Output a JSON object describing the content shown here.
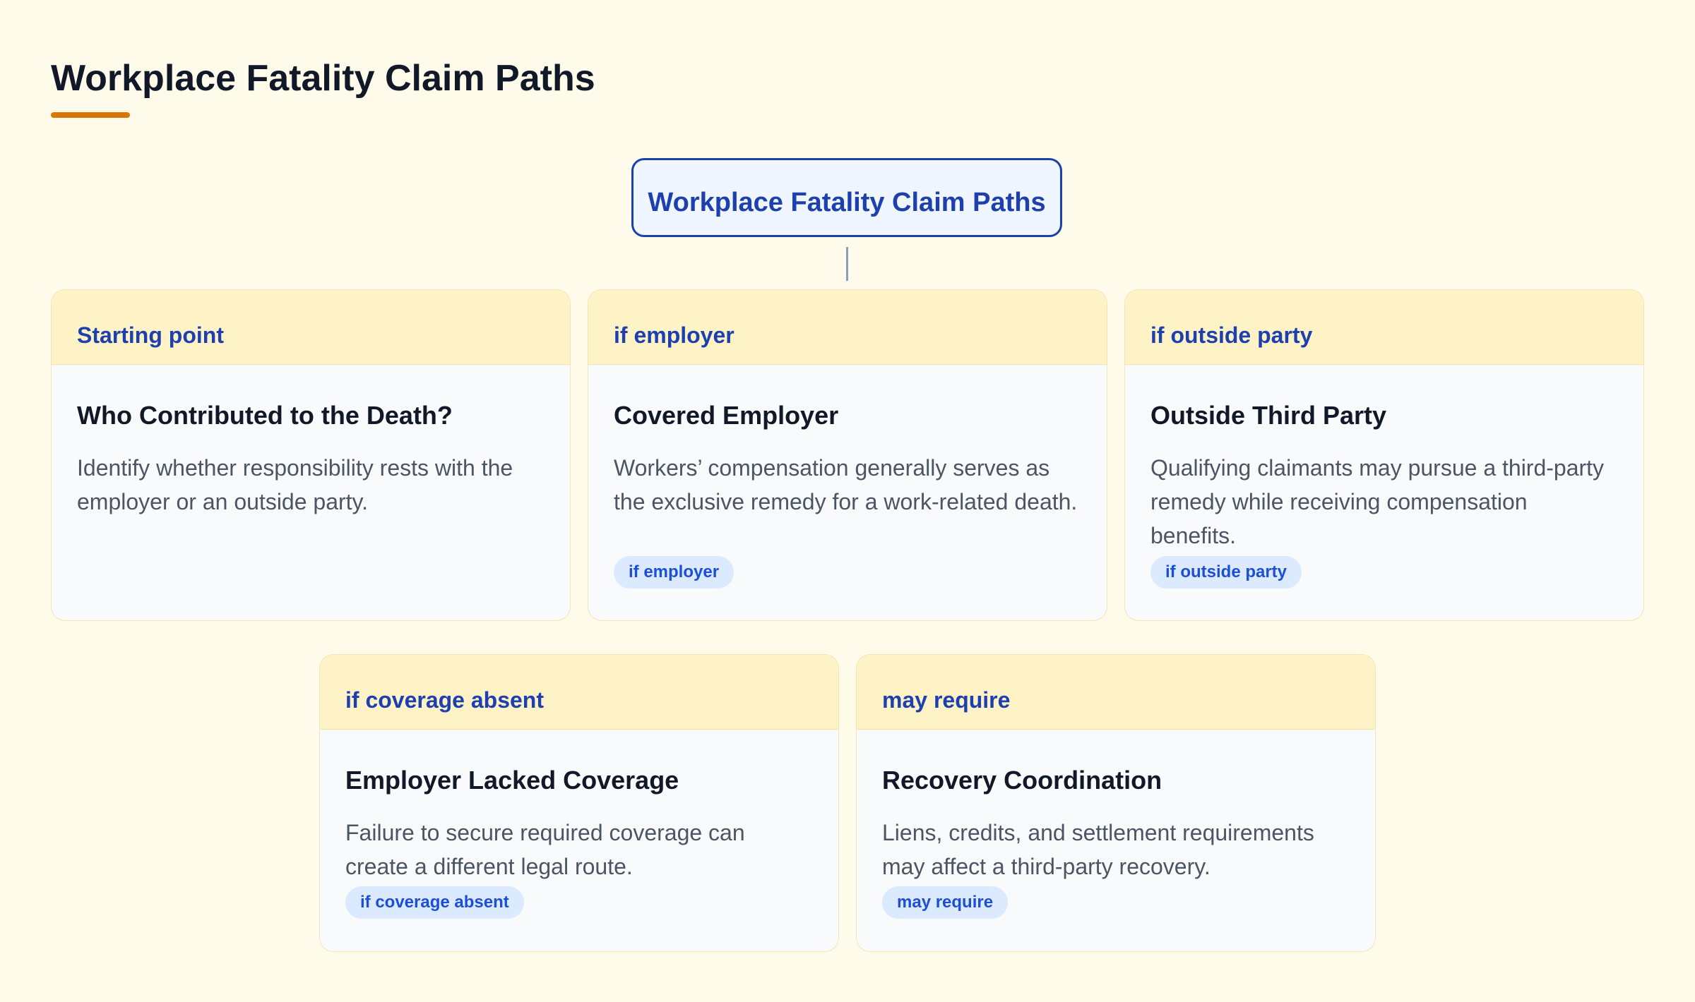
{
  "page": {
    "title": "Workplace Fatality Claim Paths"
  },
  "root": {
    "label": "Workplace Fatality Claim Paths"
  },
  "cards": [
    {
      "tag": "Starting point",
      "title": "Who Contributed to the Death?",
      "description": "Identify whether responsibility rests with the employer or an outside party.",
      "badge": ""
    },
    {
      "tag": "if employer",
      "title": "Covered Employer",
      "description": "Workers’ compensation generally serves as the exclusive remedy for a work-related death.",
      "badge": "if employer"
    },
    {
      "tag": "if outside party",
      "title": "Outside Third Party",
      "description": "Qualifying claimants may pursue a third-party remedy while receiving compensation benefits.",
      "badge": "if outside party"
    },
    {
      "tag": "if coverage absent",
      "title": "Employer Lacked Coverage",
      "description": "Failure to secure required coverage can create a different legal route.",
      "badge": "if coverage absent"
    },
    {
      "tag": "may require",
      "title": "Recovery Coordination",
      "description": "Liens, credits, and settlement requirements may affect a third-party recovery.",
      "badge": "may require"
    }
  ],
  "colors": {
    "background": "#fffbea",
    "accent": "#d97706",
    "primary": "#1e40af",
    "card_header": "#fef3c7",
    "badge_bg": "#dbeafe"
  }
}
